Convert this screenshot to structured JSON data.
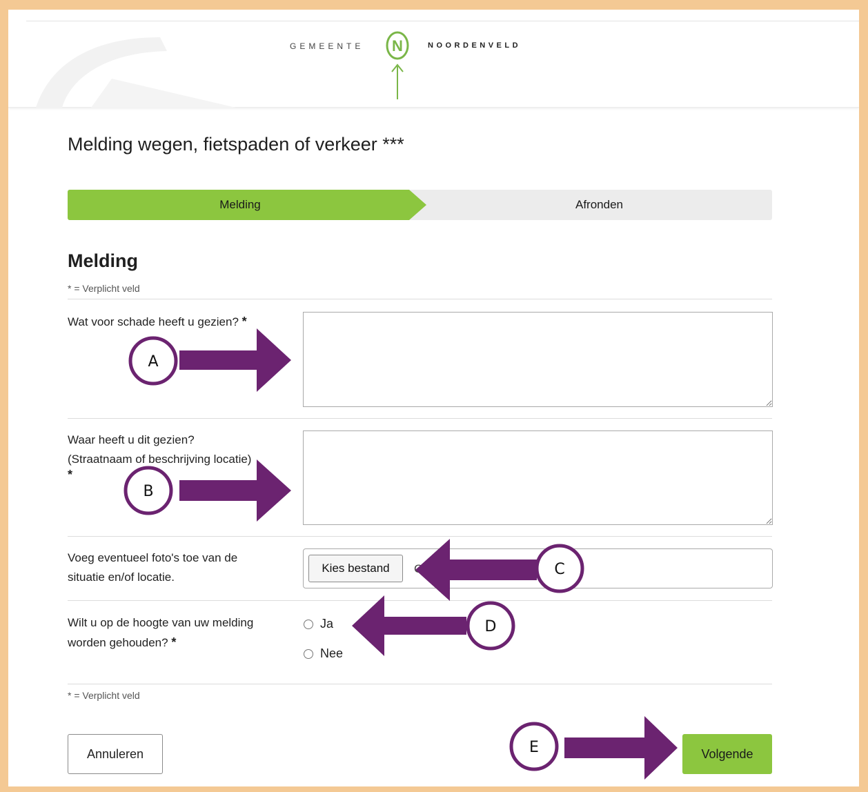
{
  "header": {
    "logo_left": "GEMEENTE",
    "logo_right": "NOORDENVELD",
    "logo_letter": "N"
  },
  "page_title": "Melding wegen, fietspaden of verkeer ***",
  "steps": [
    {
      "label": "Melding",
      "active": true
    },
    {
      "label": "Afronden",
      "active": false
    }
  ],
  "section": {
    "title": "Melding",
    "required_note": "* = Verplicht veld"
  },
  "fields": {
    "damage": {
      "label": "Wat voor schade heeft u gezien?",
      "required_mark": "*",
      "value": ""
    },
    "location": {
      "label_line1": "Waar heeft u dit gezien?",
      "label_line2": "(Straatnaam of beschrijving locatie)",
      "required_mark": "*",
      "value": ""
    },
    "photos": {
      "label_line1": "Voeg eventueel foto's toe van de",
      "label_line2": "situatie en/of locatie.",
      "button_label": "Kies bestand",
      "status_prefix": "G",
      "status_suffix": "ee",
      "status_end": "er)"
    },
    "keep_informed": {
      "label_line1": "Wilt u op de hoogte van uw melding",
      "label_line2": "worden gehouden?",
      "required_mark": "*",
      "options": [
        "Ja",
        "Nee"
      ]
    }
  },
  "footer": {
    "required_note": "* = Verplicht veld",
    "cancel_label": "Annuleren",
    "next_label": "Volgende"
  },
  "annotations": {
    "color": "#6b2370",
    "markers": [
      "A",
      "B",
      "C",
      "D",
      "E"
    ]
  },
  "colors": {
    "brand_green": "#8cc63f",
    "frame": "#f4c994"
  }
}
